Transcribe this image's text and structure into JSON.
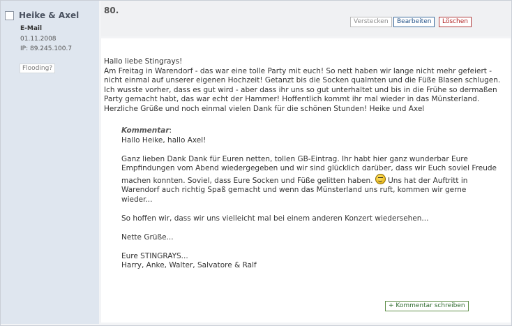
{
  "entry": {
    "number": "80.",
    "author": "Heike & Axel",
    "email_label": "E-Mail",
    "date": "01.11.2008",
    "ip": "IP: 89.245.100.7",
    "flood_label": "Flooding?"
  },
  "actions": {
    "hide": "Verstecken",
    "edit": "Bearbeiten",
    "delete": "Löschen",
    "add_comment": "+ Kommentar schreiben"
  },
  "message": {
    "greeting": "Hallo liebe Stingrays!",
    "body": "Am Freitag in Warendorf - das war eine tolle Party mit euch! So nett haben wir lange nicht mehr gefeiert - nicht einmal auf unserer eigenen Hochzeit! Getanzt bis die Socken qualmten und die Füße Blasen schlugen. Ich wusste vorher, dass es gut wird - aber dass ihr uns so gut unterhaltet und bis in die Frühe so dermaßen Party gemacht habt, das war echt der Hammer! Hoffentlich kommt ihr mal wieder in das Münsterland. Herzliche Grüße und noch einmal vielen Dank für die schönen Stunden! Heike und Axel"
  },
  "comment": {
    "title": "Kommentar",
    "colon": ":",
    "line1": "Hallo Heike, hallo Axel!",
    "para2_a": "Ganz lieben Dank Dank für Euren netten, tollen GB-Eintrag. Ihr habt hier ganz wunderbar Eure Empfindungen vom Abend wiedergegeben und wir sind glücklich darüber, dass wir Euch soviel Freude machen konnten. Soviel, dass Eure Socken und Füße gelitten haben. ",
    "para2_b": " Uns hat der Auftritt in Warendorf auch richtig Spaß gemacht und wenn das Münsterland uns ruft, kommen wir gerne wieder...",
    "para3": "So hoffen wir, dass wir uns vielleicht mal bei einem anderen Konzert wiedersehen...",
    "para4": "Nette Grüße...",
    "sign1": "Eure STINGRAYS...",
    "sign2": "Harry, Anke, Walter, Salvatore & Ralf"
  }
}
